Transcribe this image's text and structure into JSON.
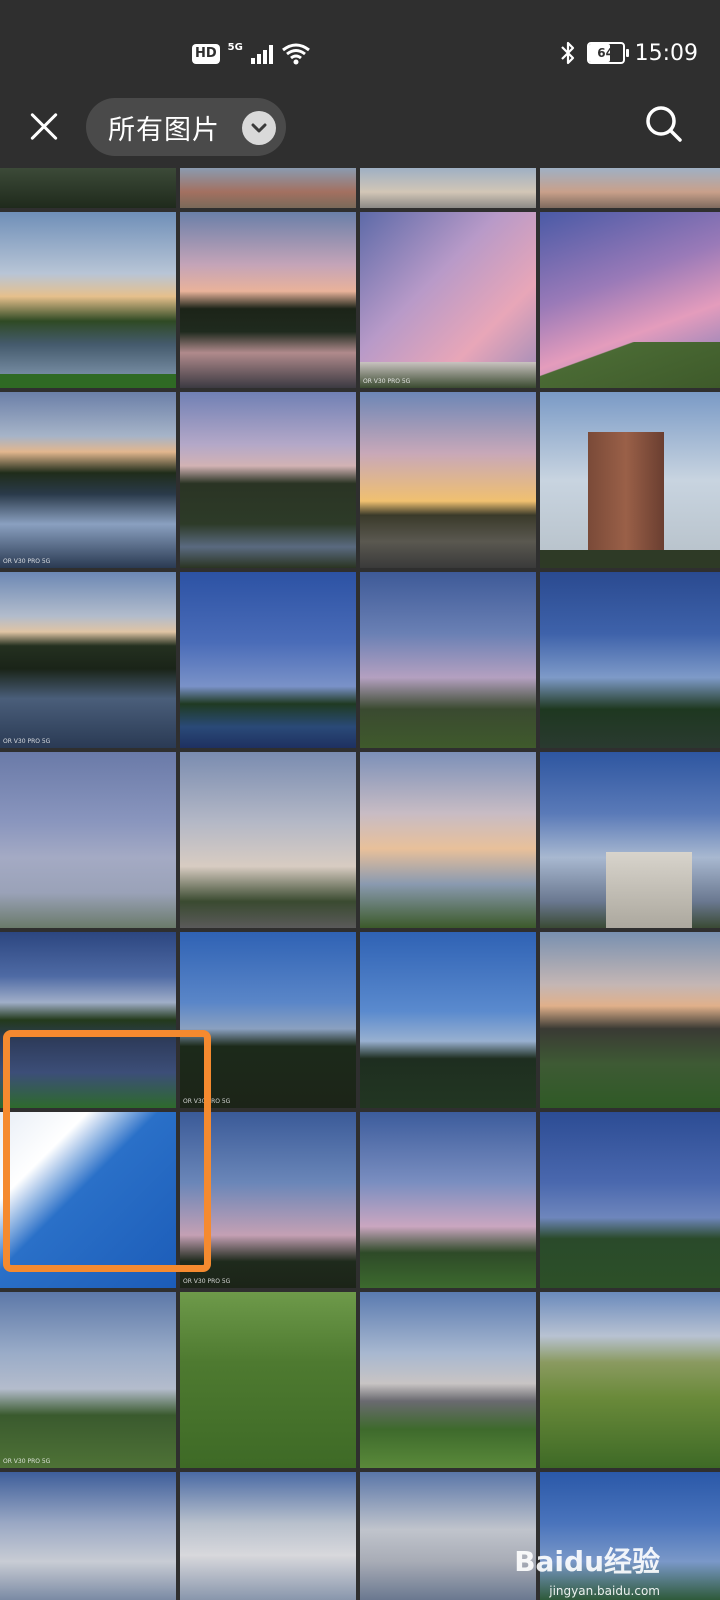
{
  "status_bar": {
    "hd": "HD",
    "network": "5G",
    "battery": "64",
    "battery_level": 0.64,
    "time": "15:09",
    "icons": [
      "signal-icon",
      "wifi-icon",
      "bluetooth-icon",
      "battery-icon"
    ]
  },
  "toolbar": {
    "album_label": "所有图片",
    "close_icon": "close-icon",
    "dropdown_icon": "chevron-down-icon",
    "search_icon": "search-icon"
  },
  "photo_overlay_text": "OR V30 PRO 5G",
  "watermark": {
    "logo": "Baidu经验",
    "url": "jingyan.baidu.com"
  },
  "colors": {
    "background": "#2f2f2f",
    "chip": "#4a4a4a",
    "highlight": "#f58a2f"
  }
}
